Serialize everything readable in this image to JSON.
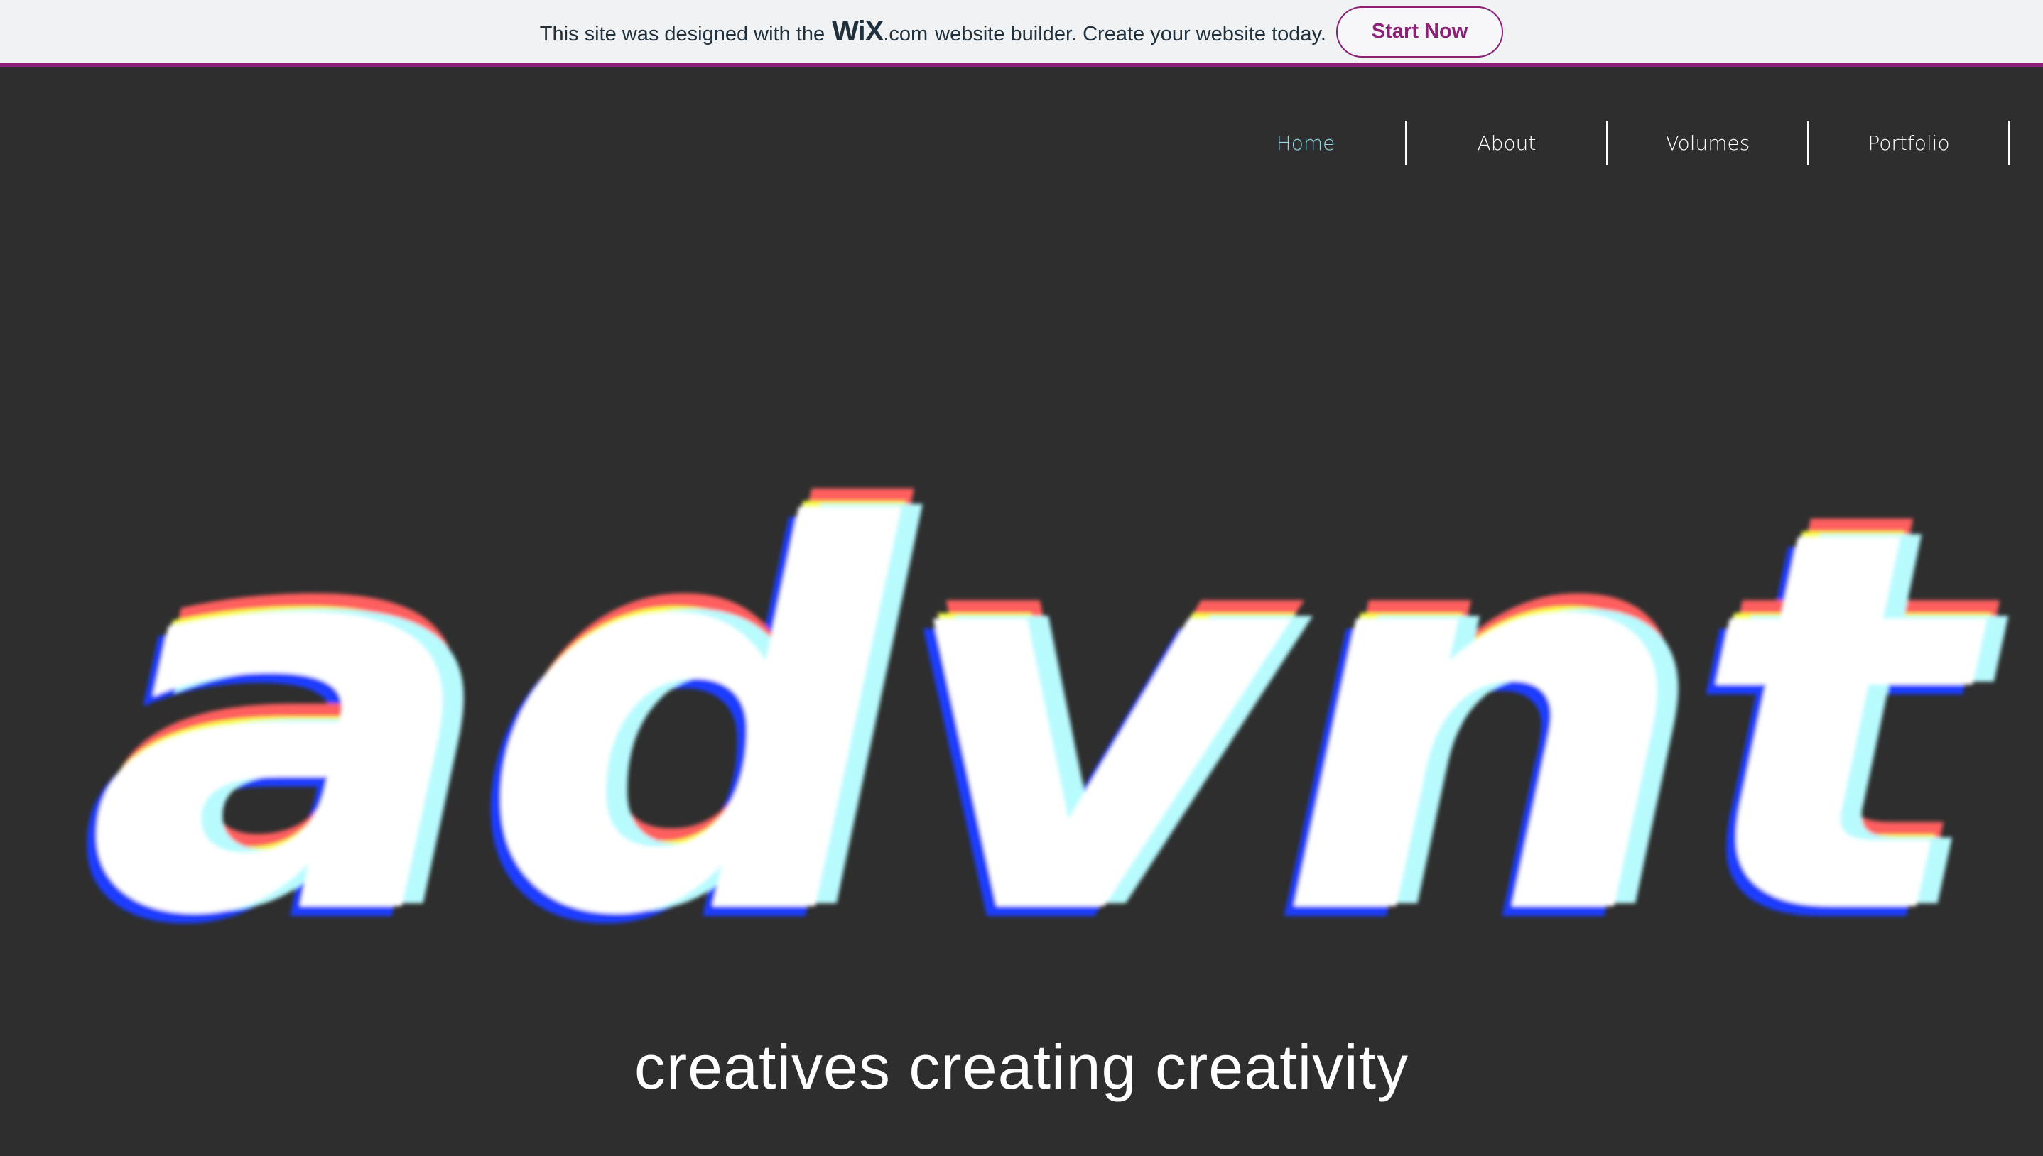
{
  "banner": {
    "text_before": "This site was designed with the",
    "wix_mark": "WiX",
    "wix_domain": ".com",
    "text_after": "website builder. Create your website today.",
    "cta_label": "Start Now",
    "accent_color": "#8c1f76"
  },
  "nav": {
    "items": [
      {
        "label": "Home",
        "active": true
      },
      {
        "label": "About",
        "active": false
      },
      {
        "label": "Volumes",
        "active": false
      },
      {
        "label": "Portfolio",
        "active": false
      }
    ],
    "active_color": "#8fd8e3"
  },
  "hero": {
    "logo_text": "advnt",
    "glitch_colors": [
      "#ff5e5e",
      "#f6ff3a",
      "#1a3cff",
      "#b8fbff",
      "#ffffff"
    ]
  },
  "tagline": "creatives creating creativity"
}
